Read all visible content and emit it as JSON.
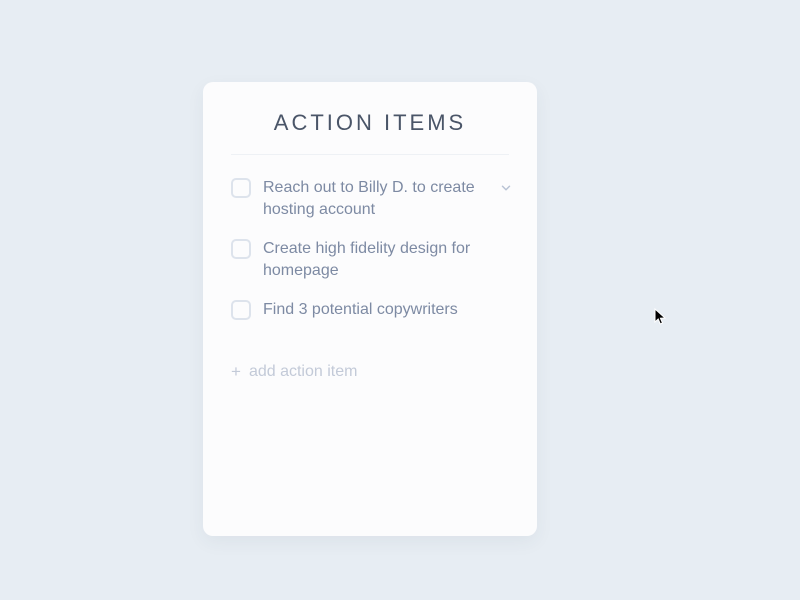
{
  "card": {
    "title": "ACTION ITEMS",
    "items": [
      {
        "label": "Reach out to Billy D. to create hosting account",
        "checked": false,
        "expandable": true
      },
      {
        "label": "Create high fidelity design for homepage",
        "checked": false,
        "expandable": false
      },
      {
        "label": "Find 3 potential copywriters",
        "checked": false,
        "expandable": false
      }
    ],
    "add_label": "add action item"
  },
  "colors": {
    "background": "#e7edf3",
    "card_bg": "#fcfcfd",
    "title_text": "#4a5568",
    "item_text": "#7d8aa3",
    "checkbox_border": "#dde3ec",
    "muted": "#c3cad8"
  }
}
